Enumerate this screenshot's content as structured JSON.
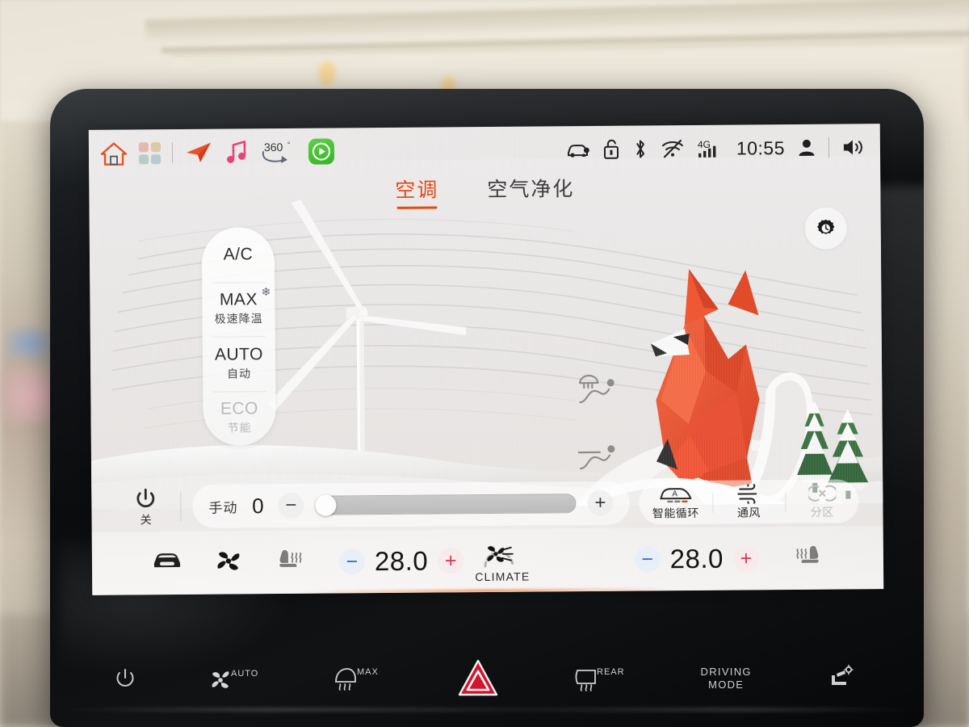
{
  "statusbar": {
    "left_icons": [
      {
        "name": "home-icon",
        "glyph": "home"
      },
      {
        "name": "apps-grid-icon",
        "glyph": "grid"
      },
      {
        "name": "navigation-icon",
        "glyph": "nav-arrow"
      },
      {
        "name": "music-icon",
        "glyph": "music-note"
      },
      {
        "name": "surround-view-360-icon",
        "label": "360°"
      },
      {
        "name": "carplay-icon",
        "glyph": "play"
      }
    ],
    "degree_label": "360",
    "degree_sup": "°",
    "right_icons": [
      {
        "name": "car-location-icon"
      },
      {
        "name": "unlock-icon"
      },
      {
        "name": "bluetooth-icon"
      },
      {
        "name": "wifi-off-icon"
      },
      {
        "name": "cellular-4g-icon",
        "label": "4G"
      },
      {
        "name": "user-profile-icon"
      },
      {
        "name": "volume-icon"
      }
    ],
    "network_label": "4G",
    "time": "10:55"
  },
  "tabs": [
    {
      "label": "空调",
      "active": true
    },
    {
      "label": "空气净化",
      "active": false
    }
  ],
  "modes": [
    {
      "en": "A/C",
      "cn": "",
      "dim": false,
      "snow": false
    },
    {
      "en": "MAX",
      "cn": "极速降温",
      "dim": false,
      "snow": true
    },
    {
      "en": "AUTO",
      "cn": "自动",
      "dim": false,
      "snow": false
    },
    {
      "en": "ECO",
      "cn": "节能",
      "dim": true,
      "snow": false
    }
  ],
  "snowflake_glyph": "❄",
  "fan": {
    "power_label": "关",
    "mode_label": "手动",
    "value": "0",
    "minus": "−",
    "plus": "+",
    "slider_percent": 0
  },
  "air_modes": [
    {
      "label": "智能循环",
      "icon": "car-auto-recirculation-icon",
      "dim": false
    },
    {
      "label": "通风",
      "icon": "ventilation-icon",
      "dim": false
    },
    {
      "label": "分区",
      "icon": "dual-zone-icon",
      "dim": true
    }
  ],
  "dock": {
    "car_icon": "car-front-icon",
    "fan_icon": "fan-icon",
    "left_seat_icon": "heated-seat-left-icon",
    "right_seat_icon": "heated-seat-right-icon",
    "left_temp": "28.0",
    "right_temp": "28.0",
    "minus": "−",
    "plus": "+",
    "climate_label": "CLIMATE"
  },
  "hardware_buttons": [
    {
      "name": "power-button",
      "label": ""
    },
    {
      "name": "fan-auto-button",
      "label": "AUTO"
    },
    {
      "name": "max-defrost-button",
      "label": "MAX"
    },
    {
      "name": "hazard-button",
      "label": ""
    },
    {
      "name": "rear-defrost-button",
      "label": "REAR"
    },
    {
      "name": "driving-mode-button",
      "label": "DRIVING\nMODE"
    },
    {
      "name": "seat-adjust-button",
      "label": ""
    }
  ],
  "hw_labels": {
    "auto": "AUTO",
    "max": "MAX",
    "rear": "REAR",
    "driving": "DRIVING",
    "mode": "MODE"
  },
  "colors": {
    "accent": "#e24a17",
    "fox": "#ef4b23",
    "hazard": "#e0233c",
    "minus": "#2f6fc4",
    "plus": "#d2384e"
  }
}
